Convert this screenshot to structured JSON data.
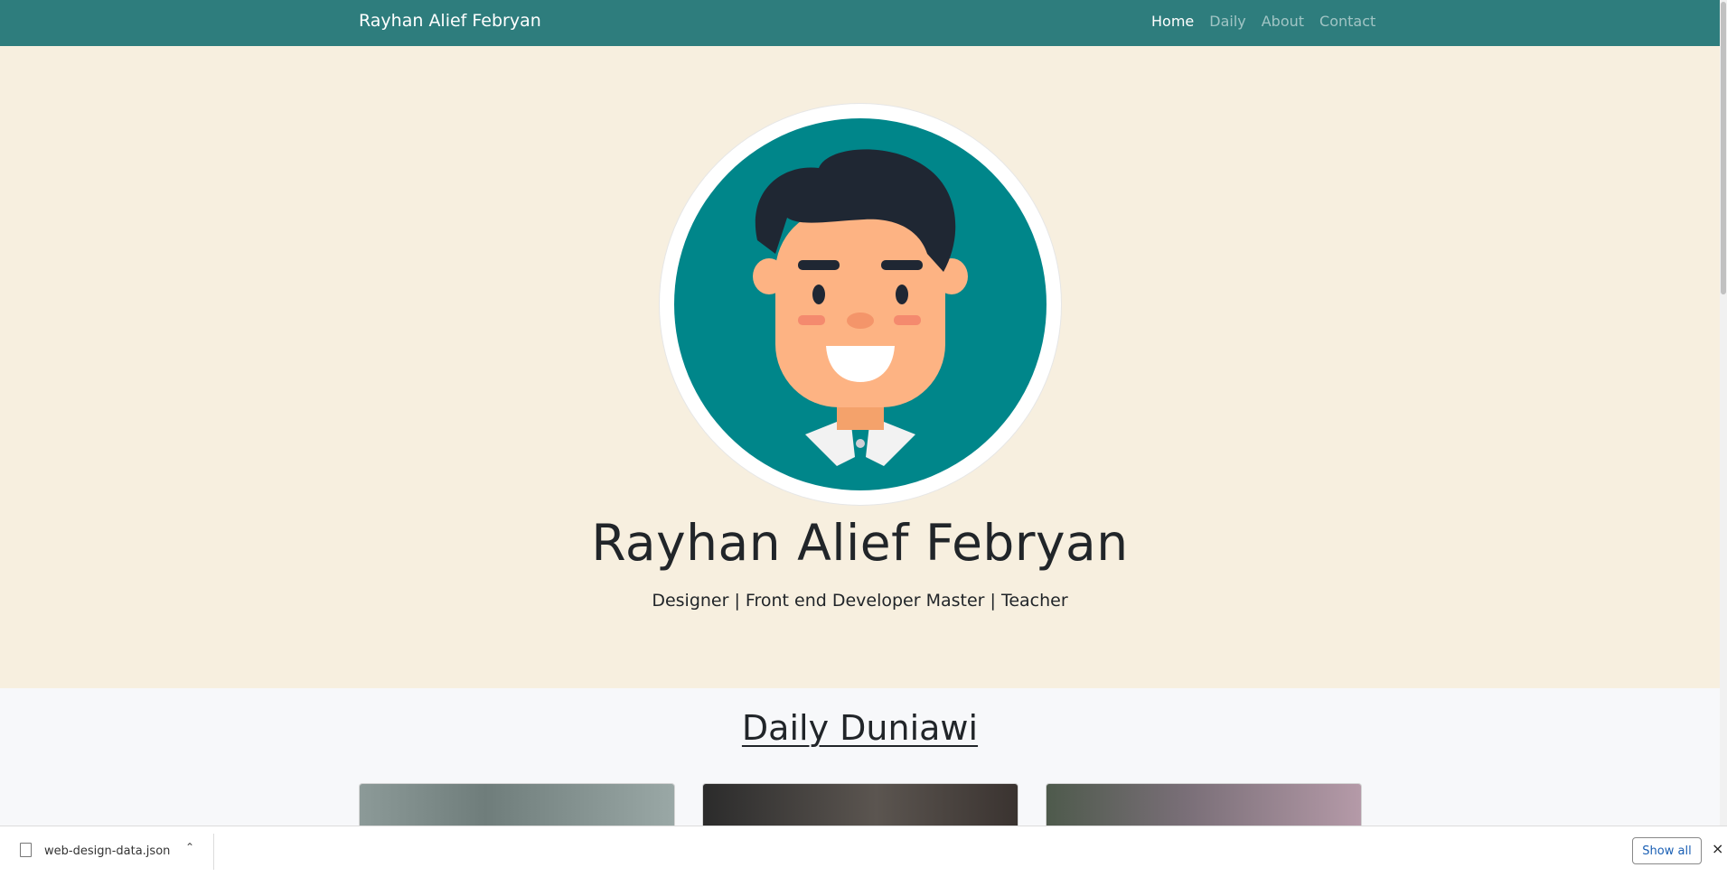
{
  "navbar": {
    "brand": "Rayhan Alief Febryan",
    "links": [
      {
        "label": "Home",
        "active": true
      },
      {
        "label": "Daily",
        "active": false
      },
      {
        "label": "About",
        "active": false
      },
      {
        "label": "Contact",
        "active": false
      }
    ]
  },
  "hero": {
    "title": "Rayhan Alief Febryan",
    "subtitle": "Designer | Front end Developer Master | Teacher",
    "avatar_icon": "cartoon-boy-avatar-icon"
  },
  "daily": {
    "title": "Daily Duniawi"
  },
  "download_bar": {
    "file_name": "web-design-data.json",
    "show_all_label": "Show all",
    "close_icon": "×"
  },
  "colors": {
    "navbar_bg": "#2e7d7d",
    "hero_bg": "#f7efdf",
    "avatar_bg": "#00868a"
  }
}
